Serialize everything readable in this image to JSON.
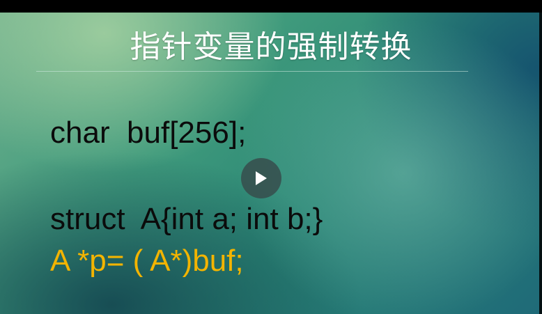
{
  "slide": {
    "title": "指针变量的强制转换",
    "code_lines": [
      "char  buf[256];",
      "struct  A{int a; int b;}",
      "A *p= ( A*)buf;"
    ],
    "highlight_color": "#f3b400"
  },
  "player": {
    "play_icon": "play-icon"
  }
}
